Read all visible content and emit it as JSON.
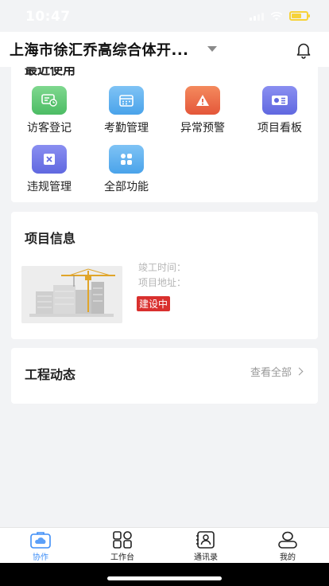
{
  "status_bar": {
    "time": "10:47"
  },
  "header": {
    "project_title": "上海市徐汇乔高综合体开..."
  },
  "recent": {
    "heading": "最近使用",
    "items": [
      {
        "label": "访客登记",
        "icon": "visitor-icon",
        "color": "#5cc470"
      },
      {
        "label": "考勤管理",
        "icon": "calendar-icon",
        "color": "#56abee"
      },
      {
        "label": "异常预警",
        "icon": "warning-icon",
        "color": "#ea6442"
      },
      {
        "label": "项目看板",
        "icon": "dashboard-icon",
        "color": "#6b72e6"
      },
      {
        "label": "违规管理",
        "icon": "violation-icon",
        "color": "#6b72e6"
      },
      {
        "label": "全部功能",
        "icon": "apps-grid-icon",
        "color": "#56abee"
      }
    ]
  },
  "project_info": {
    "title": "项目信息",
    "completion_label": "竣工时间：",
    "address_label": "项目地址：",
    "status": "建设中"
  },
  "news": {
    "title": "工程动态",
    "view_all": "查看全部"
  },
  "tabbar": {
    "tabs": [
      {
        "label": "协作",
        "icon": "cloud-briefcase-icon",
        "active": true
      },
      {
        "label": "工作台",
        "icon": "workbench-grid-icon",
        "active": false
      },
      {
        "label": "通讯录",
        "icon": "contacts-icon",
        "active": false
      },
      {
        "label": "我的",
        "icon": "user-icon",
        "active": false
      }
    ]
  },
  "colors": {
    "accent": "#3e8ef7",
    "status_badge": "#d9302e"
  }
}
